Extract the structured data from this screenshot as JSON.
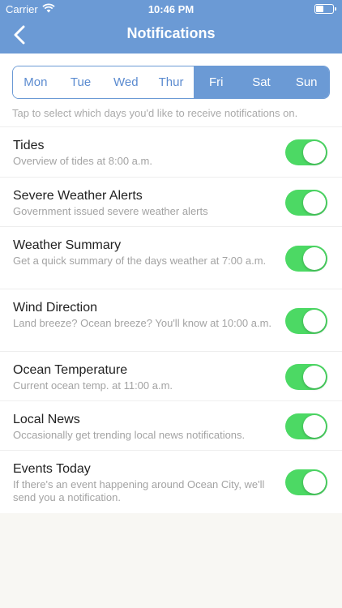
{
  "status_bar": {
    "carrier": "Carrier",
    "time": "10:46 PM"
  },
  "nav": {
    "title": "Notifications",
    "back_icon": "chevron-left-icon"
  },
  "days": [
    {
      "label": "Mon",
      "selected": false
    },
    {
      "label": "Tue",
      "selected": false
    },
    {
      "label": "Wed",
      "selected": false
    },
    {
      "label": "Thur",
      "selected": false
    },
    {
      "label": "Fri",
      "selected": true
    },
    {
      "label": "Sat",
      "selected": true
    },
    {
      "label": "Sun",
      "selected": true
    }
  ],
  "hint": "Tap to select which days you'd like to receive notifications on.",
  "settings": [
    {
      "title": "Tides",
      "description": "Overview of tides at 8:00 a.m.",
      "enabled": true
    },
    {
      "title": "Severe Weather Alerts",
      "description": "Government issued severe weather alerts",
      "enabled": true
    },
    {
      "title": "Weather Summary",
      "description": "Get a quick summary of the days weather at 7:00 a.m.",
      "enabled": true
    },
    {
      "title": "Wind Direction",
      "description": "Land breeze? Ocean breeze? You'll know at 10:00 a.m.",
      "enabled": true
    },
    {
      "title": "Ocean Temperature",
      "description": "Current ocean temp. at 11:00 a.m.",
      "enabled": true
    },
    {
      "title": "Local News",
      "description": "Occasionally get trending local news notifications.",
      "enabled": true
    },
    {
      "title": "Events Today",
      "description": "If there's an event happening around Ocean City, we'll send you a notification.",
      "enabled": true
    }
  ],
  "colors": {
    "accent": "#6b9ad5",
    "toggle_on": "#4cd964"
  }
}
